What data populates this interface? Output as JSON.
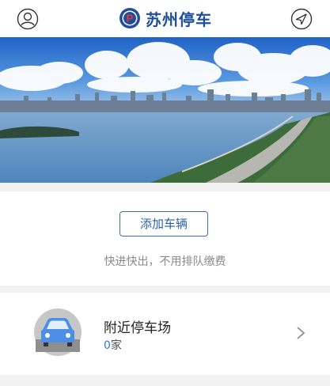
{
  "header": {
    "brand": "苏州停车",
    "logo_letter": "P",
    "user_icon": "user-icon",
    "location_icon": "navigation-arrow-icon"
  },
  "add_vehicle": {
    "button_label": "添加车辆",
    "tagline": "快进快出，不用排队缴费"
  },
  "nearby": {
    "title": "附近停车场",
    "count": "0",
    "unit": "家",
    "icon": "car-icon",
    "chevron_icon": "chevron-right-icon"
  },
  "colors": {
    "brand": "#1f4e9c",
    "accent": "#2f78d6",
    "background": "#f2f2f2"
  }
}
